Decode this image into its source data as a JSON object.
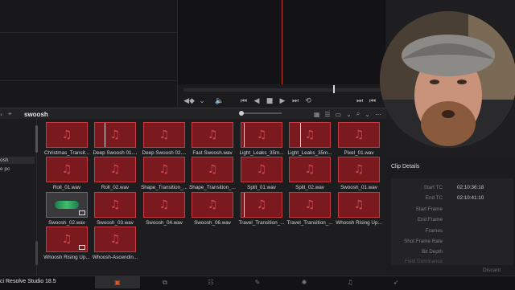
{
  "media_pool": {
    "bin_name": "swoosh",
    "sidebar_items": [
      "osh",
      "e pc"
    ],
    "clips": [
      {
        "name": "Christmas_Transit..."
      },
      {
        "name": "Deep Swoosh 01...."
      },
      {
        "name": "Deep Swoosh 02...."
      },
      {
        "name": "Fast Swoosh.wav"
      },
      {
        "name": "Light_Leaks_35m..."
      },
      {
        "name": "Light_Leaks_35m..."
      },
      {
        "name": "Pixel_01.wav"
      },
      {
        "name": "Roll_01.wav"
      },
      {
        "name": "Roll_02.wav"
      },
      {
        "name": "Shape_Transition_..."
      },
      {
        "name": "Shape_Transition_..."
      },
      {
        "name": "Split_01.wav"
      },
      {
        "name": "Split_02.wav"
      },
      {
        "name": "Swoosh_01.wav"
      },
      {
        "name": "Swoosh_02.wav"
      },
      {
        "name": "Swoosh_03.wav"
      },
      {
        "name": "Swoosh_04.wav"
      },
      {
        "name": "Swoosh_06.wav"
      },
      {
        "name": "Travel_Transition_..."
      },
      {
        "name": "Travel_Transition_..."
      },
      {
        "name": "Whoosh Rising Up..."
      },
      {
        "name": "Whoosh Rising Up..."
      },
      {
        "name": "Whoosh-Ascendin..."
      }
    ]
  },
  "clip_details": {
    "title": "Clip Details",
    "rows": [
      {
        "label": "Start TC",
        "value": "02:10:36:18"
      },
      {
        "label": "End TC",
        "value": "02:10:41:10"
      },
      {
        "label": "Start Frame",
        "value": ""
      },
      {
        "label": "End Frame",
        "value": ""
      },
      {
        "label": "Frames",
        "value": ""
      },
      {
        "label": "Shot Frame Rate",
        "value": ""
      },
      {
        "label": "Bit Depth",
        "value": ""
      },
      {
        "label": "Field Dominance",
        "value": ""
      }
    ],
    "discard_label": "Discard"
  },
  "app": {
    "name": "ci Resolve Studio 18.5"
  },
  "colors": {
    "clip_red": "#7a1a1f",
    "clip_border": "#c73a3f",
    "active_page": "#e05a2a",
    "playhead": "#c0392b"
  }
}
